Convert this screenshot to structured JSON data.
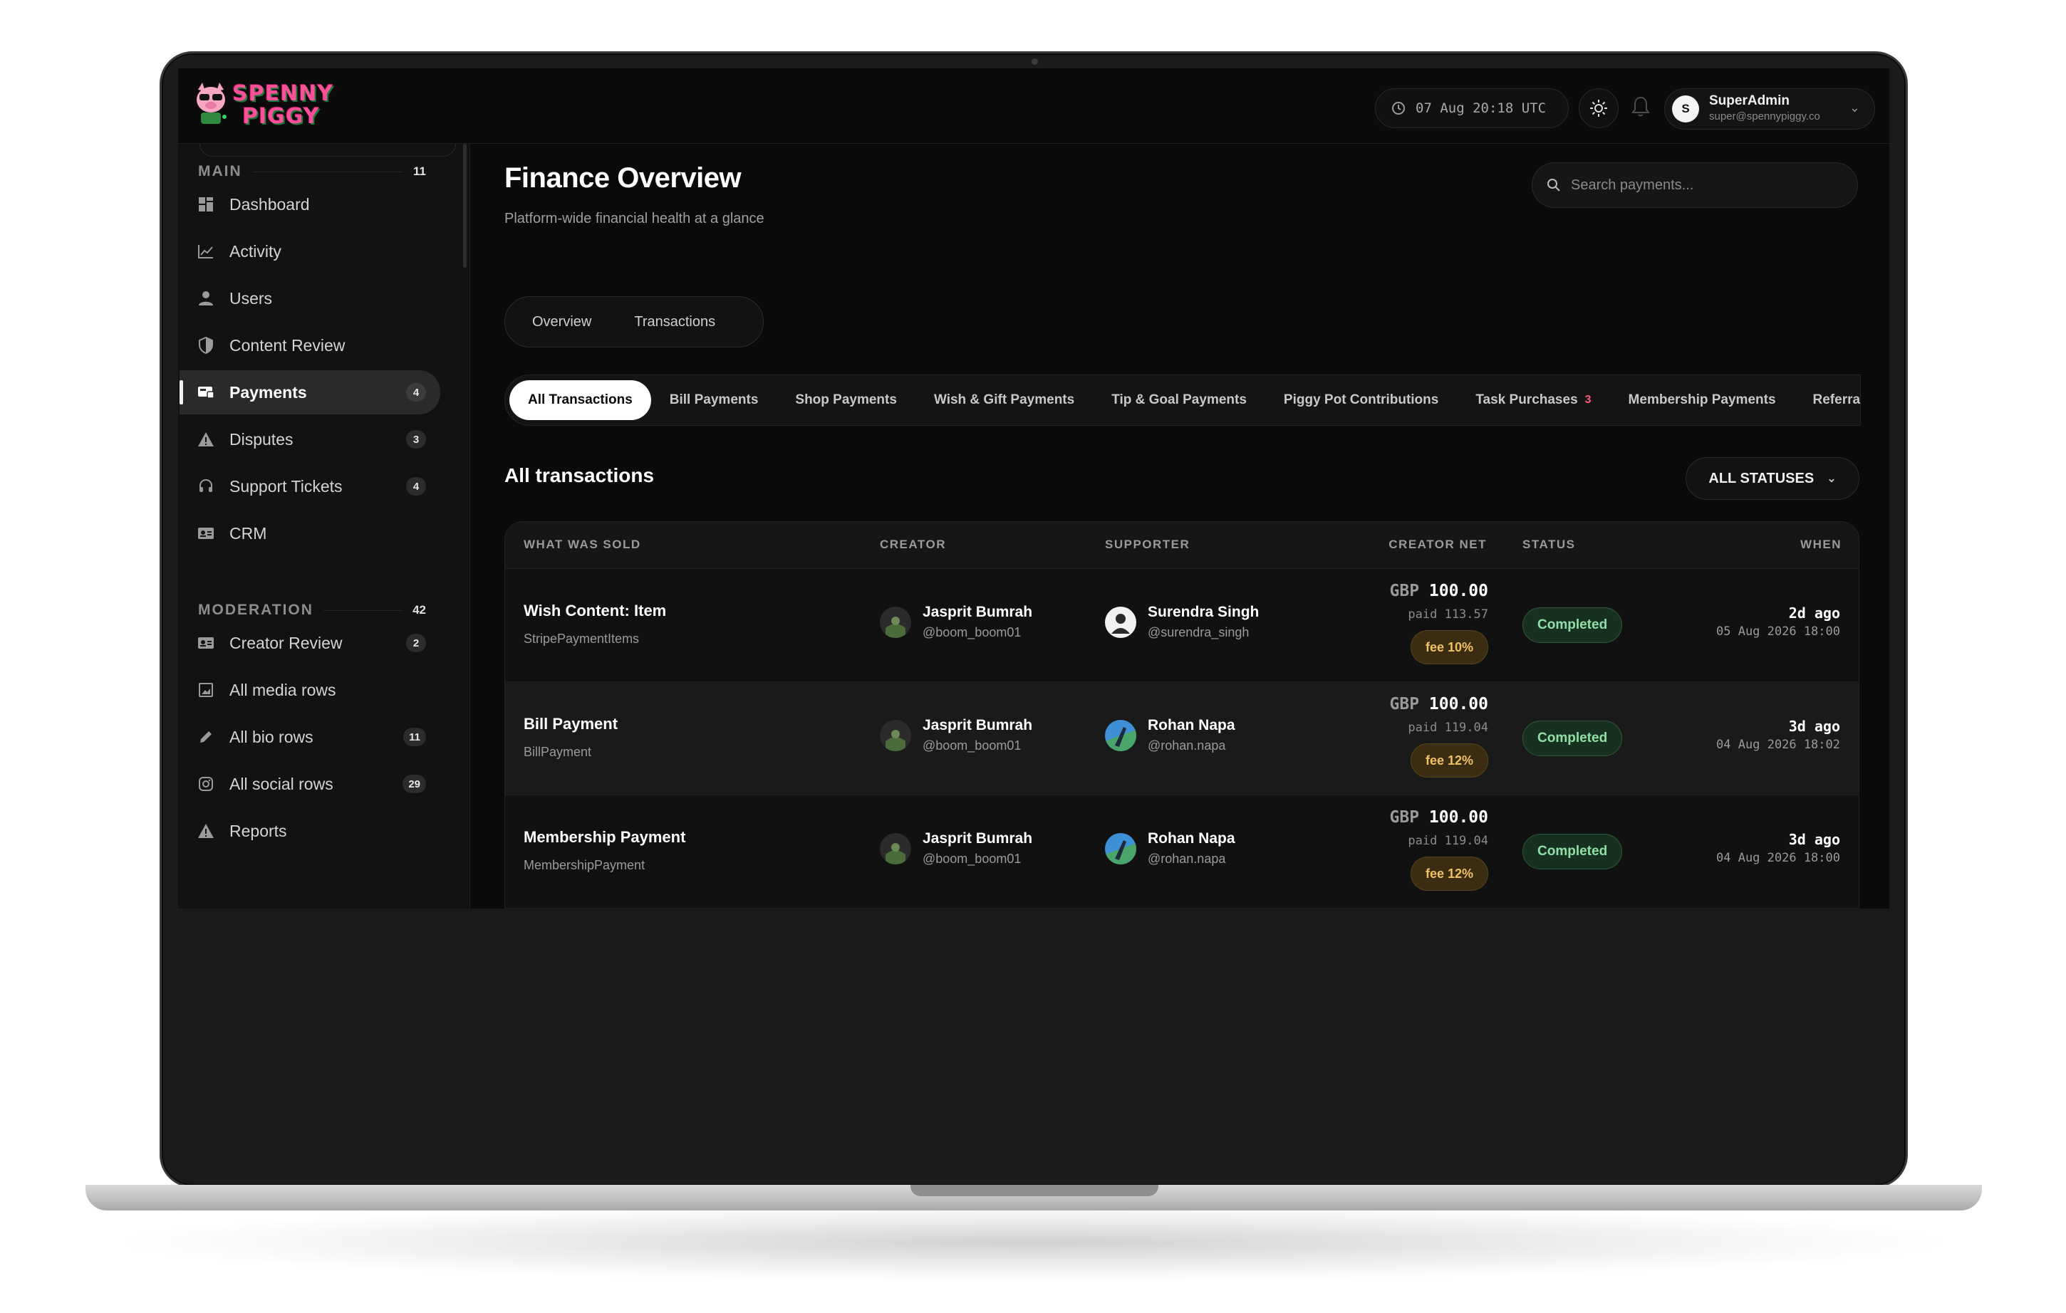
{
  "app": {
    "logo_text_line1": "SPENNY",
    "logo_text_line2": "PIGGY"
  },
  "topbar": {
    "clock": "07 Aug 20:18 UTC",
    "user": {
      "initial": "S",
      "name": "SuperAdmin",
      "email": "super@spennypiggy.co"
    }
  },
  "sidebar": {
    "main": {
      "title": "MAIN",
      "count": "11",
      "items": [
        {
          "label": "Dashboard",
          "icon": "dashboard-icon"
        },
        {
          "label": "Activity",
          "icon": "chart-line-icon"
        },
        {
          "label": "Users",
          "icon": "user-icon"
        },
        {
          "label": "Content Review",
          "icon": "shield-icon"
        },
        {
          "label": "Payments",
          "icon": "payments-icon",
          "badge": "4",
          "active": true
        },
        {
          "label": "Disputes",
          "icon": "warning-icon",
          "badge": "3"
        },
        {
          "label": "Support Tickets",
          "icon": "headset-icon",
          "badge": "4"
        },
        {
          "label": "CRM",
          "icon": "id-card-icon"
        }
      ]
    },
    "moderation": {
      "title": "MODERATION",
      "count": "42",
      "items": [
        {
          "label": "Creator Review",
          "icon": "id-card-icon",
          "badge": "2"
        },
        {
          "label": "All media rows",
          "icon": "image-icon"
        },
        {
          "label": "All bio rows",
          "icon": "pencil-icon",
          "badge": "11"
        },
        {
          "label": "All social rows",
          "icon": "instagram-icon",
          "badge": "29"
        },
        {
          "label": "Reports",
          "icon": "warning-icon"
        }
      ]
    }
  },
  "main": {
    "title": "Finance Overview",
    "subtitle": "Platform-wide financial health at a glance",
    "search_placeholder": "Search payments...",
    "segments": [
      "Overview",
      "Transactions"
    ],
    "tabs": [
      {
        "label": "All Transactions",
        "active": true
      },
      {
        "label": "Bill Payments"
      },
      {
        "label": "Shop Payments"
      },
      {
        "label": "Wish & Gift Payments"
      },
      {
        "label": "Tip & Goal Payments"
      },
      {
        "label": "Piggy Pot Contributions"
      },
      {
        "label": "Task Purchases",
        "count": "3"
      },
      {
        "label": "Membership Payments"
      },
      {
        "label": "Referral"
      }
    ],
    "section_title": "All transactions",
    "status_filter": "ALL STATUSES",
    "table": {
      "headers": {
        "what": "WHAT WAS SOLD",
        "creator": "CREATOR",
        "supporter": "SUPPORTER",
        "net": "CREATOR NET",
        "status": "STATUS",
        "when": "WHEN"
      },
      "rows": [
        {
          "title": "Wish Content: Item",
          "type": "StripePaymentItems",
          "creator": {
            "name": "Jasprit Bumrah",
            "handle": "@boom_boom01"
          },
          "supporter": {
            "name": "Surendra Singh",
            "handle": "@surendra_singh"
          },
          "currency": "GBP",
          "net": "100.00",
          "paid": "paid 113.57",
          "fee": "fee 10%",
          "status": "Completed",
          "when_rel": "2d ago",
          "when_abs": "05 Aug 2026 18:00"
        },
        {
          "title": "Bill Payment",
          "type": "BillPayment",
          "creator": {
            "name": "Jasprit Bumrah",
            "handle": "@boom_boom01"
          },
          "supporter": {
            "name": "Rohan Napa",
            "handle": "@rohan.napa"
          },
          "currency": "GBP",
          "net": "100.00",
          "paid": "paid 119.04",
          "fee": "fee 12%",
          "status": "Completed",
          "when_rel": "3d ago",
          "when_abs": "04 Aug 2026 18:02"
        },
        {
          "title": "Membership Payment",
          "type": "MembershipPayment",
          "creator": {
            "name": "Jasprit Bumrah",
            "handle": "@boom_boom01"
          },
          "supporter": {
            "name": "Rohan Napa",
            "handle": "@rohan.napa"
          },
          "currency": "GBP",
          "net": "100.00",
          "paid": "paid 119.04",
          "fee": "fee 12%",
          "status": "Completed",
          "when_rel": "3d ago",
          "when_abs": "04 Aug 2026 18:00"
        }
      ]
    }
  },
  "colors": {
    "background": "#0a0a0a",
    "completed_text": "#8fe0a6",
    "fee_text": "#f1c064",
    "brand_pink": "#ff4f9a"
  }
}
